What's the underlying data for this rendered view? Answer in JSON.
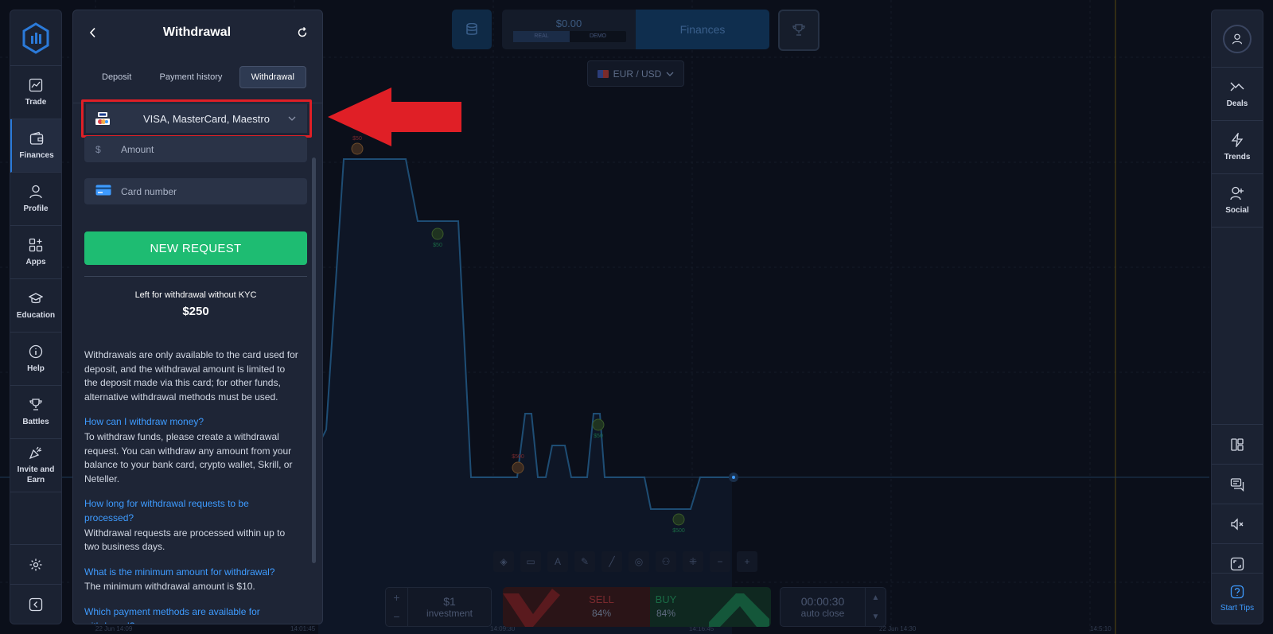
{
  "chart": {
    "pair": "EUR / USD",
    "markers": [
      {
        "label": "$50",
        "color": "#e0434b"
      },
      {
        "label": "$50",
        "color": "#1ebc72"
      },
      {
        "label": "$500",
        "color": "#e0434b"
      },
      {
        "label": "$50",
        "color": "#1ebc72"
      },
      {
        "label": "$500",
        "color": "#1ebc72"
      }
    ],
    "time_labels": [
      "22 Jun 14:09",
      "14:01:45",
      "14:09:30",
      "14:16:45",
      "22 Jun 14:30",
      "14:5:10"
    ]
  },
  "left_nav": {
    "items": [
      {
        "label": "Trade",
        "icon": "chart-line-icon"
      },
      {
        "label": "Finances",
        "icon": "wallet-icon"
      },
      {
        "label": "Profile",
        "icon": "user-icon"
      },
      {
        "label": "Apps",
        "icon": "apps-grid-icon"
      },
      {
        "label": "Education",
        "icon": "graduation-cap-icon"
      },
      {
        "label": "Help",
        "icon": "info-icon"
      },
      {
        "label": "Battles",
        "icon": "trophy-icon"
      },
      {
        "label": "Invite and Earn",
        "icon": "party-icon"
      }
    ]
  },
  "right_nav": {
    "items": [
      {
        "label": "Deals",
        "icon": "deals-icon"
      },
      {
        "label": "Trends",
        "icon": "lightning-icon"
      },
      {
        "label": "Social",
        "icon": "add-user-icon"
      }
    ],
    "start_tips": "Start Tips"
  },
  "top_bar": {
    "balance": "$0.00",
    "real": "REAL",
    "demo": "DEMO",
    "finances": "Finances"
  },
  "panel": {
    "title": "Withdrawal",
    "tabs": [
      "Deposit",
      "Payment history",
      "Withdrawal"
    ],
    "method": "VISA, MasterCard, Maestro",
    "amount_prefix": "$",
    "amount_placeholder": "Amount",
    "card_placeholder": "Card number",
    "request_button": "NEW REQUEST",
    "kyc_label": "Left for withdrawal without KYC",
    "kyc_value": "$250",
    "intro": "Withdrawals are only available to the card used for deposit, and the withdrawal amount is limited to the deposit made via this card; for other funds, alternative withdrawal methods must be used.",
    "faq": [
      {
        "q": "How can I withdraw money?",
        "a": "To withdraw funds, please create a withdrawal request. You can withdraw any amount from your balance to your bank card, crypto wallet, Skrill, or Neteller."
      },
      {
        "q": "How long for withdrawal requests to be processed?",
        "a": "Withdrawal requests are processed within up to two business days."
      },
      {
        "q": "What is the minimum amount for withdrawal?",
        "a": "The minimum withdrawal amount is $10."
      },
      {
        "q": "Which payment methods are available for withdrawal?",
        "a": ""
      }
    ]
  },
  "trade": {
    "investment_value": "$1",
    "investment_label": "investment",
    "sell_label": "SELL",
    "sell_pct": "84%",
    "buy_label": "BUY",
    "buy_pct": "84%",
    "timer_value": "00:00:30",
    "timer_label": "auto close"
  },
  "colors": {
    "accent": "#3e9bff",
    "buy": "#1ebc72",
    "sell": "#e0434b",
    "highlight": "#e01f26"
  }
}
